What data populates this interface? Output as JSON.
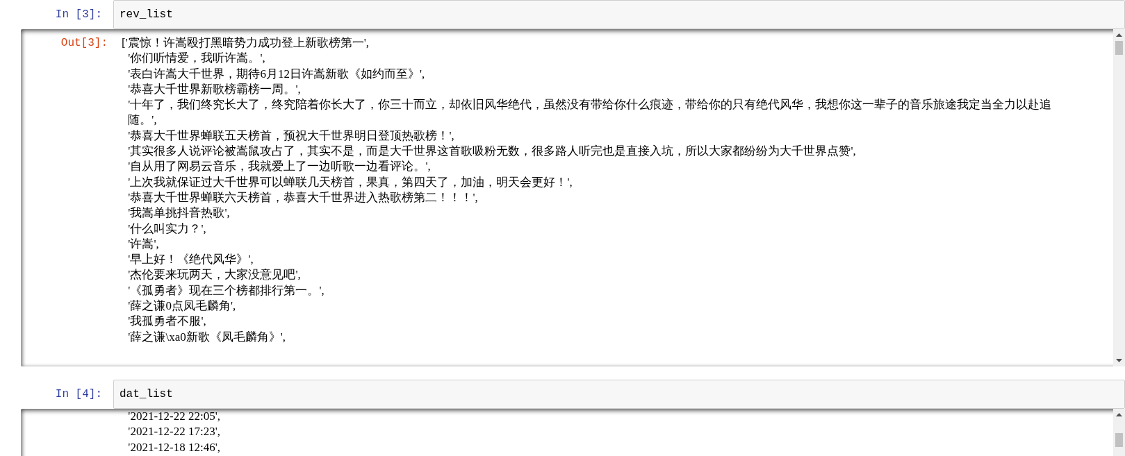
{
  "cells": [
    {
      "prompt": "In [3]:",
      "source": "rev_list",
      "output": {
        "prompt": "Out[3]:",
        "lines": [
          "['震惊！许嵩殴打黑暗势力成功登上新歌榜第一',",
          "'你们听情爱，我听许嵩。',",
          "'表白许嵩大千世界，期待6月12日许嵩新歌《如约而至》',",
          "'恭喜大千世界新歌榜霸榜一周。',",
          "'十年了，我们终究长大了，终究陪着你长大了，你三十而立，却依旧风华绝代，虽然没有带给你什么痕迹，带给你的只有绝代风华，我想你这一辈子的音乐旅途我定当全力以赴追随。',",
          "'恭喜大千世界蝉联五天榜首，预祝大千世界明日登顶热歌榜！',",
          "'其实很多人说评论被嵩鼠攻占了，其实不是，而是大千世界这首歌吸粉无数，很多路人听完也是直接入坑，所以大家都纷纷为大千世界点赞',",
          "'自从用了网易云音乐，我就爱上了一边听歌一边看评论。',",
          "'上次我就保证过大千世界可以蝉联几天榜首，果真，第四天了，加油，明天会更好！',",
          "'恭喜大千世界蝉联六天榜首，恭喜大千世界进入热歌榜第二！！！',",
          "'我嵩单挑抖音热歌',",
          "'什么叫实力？',",
          "'许嵩',",
          "'早上好！《绝代风华》',",
          "'杰伦要来玩两天，大家没意见吧',",
          "'《孤勇者》现在三个榜都排行第一。',",
          "'薛之谦0点凤毛麟角',",
          "'我孤勇者不服',",
          "'薛之谦\\xa0新歌《凤毛麟角》',"
        ]
      }
    },
    {
      "prompt": "In [4]:",
      "source": "dat_list",
      "output": {
        "lines": [
          "'2021-12-22 22:05',",
          "'2021-12-22 17:23',",
          "'2021-12-18 12:46',"
        ]
      }
    }
  ]
}
